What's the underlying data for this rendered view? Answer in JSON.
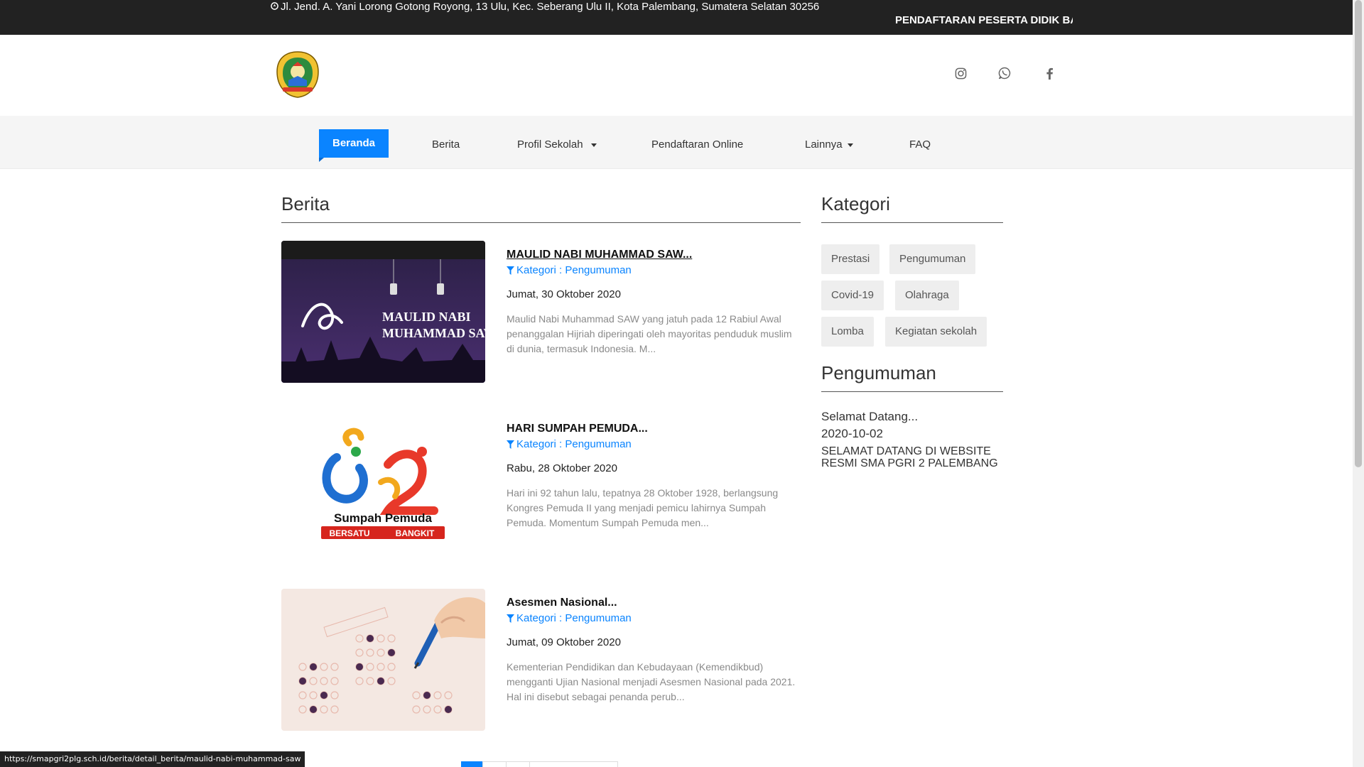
{
  "topbar": {
    "address": "Jl. Jend. A. Yani Lorong Gotong Royong, 13 Ulu, Kec. Seberang Ulu II, Kota Palembang, Sumatera Selatan 30256",
    "marquee": "PENDAFTARAN PESERTA DIDIK BA"
  },
  "header": {
    "social_icons": [
      "instagram-icon",
      "whatsapp-icon",
      "facebook-icon"
    ]
  },
  "nav": {
    "items": [
      {
        "label": "Beranda",
        "active": true
      },
      {
        "label": "Berita"
      },
      {
        "label": "Profil Sekolah",
        "dropdown": true
      },
      {
        "label": "Pendaftaran Online"
      },
      {
        "label": "Lainnya",
        "dropdown": true
      },
      {
        "label": "FAQ"
      }
    ]
  },
  "main": {
    "title": "Berita",
    "articles": [
      {
        "title": "MAULID NABI MUHAMMAD SAW...",
        "category": "Kategori : Pengumuman",
        "date": "Jumat, 30 Oktober 2020",
        "excerpt": "Maulid Nabi Muhammad SAW yang jatuh pada 12 Rabiul Awal penanggalan Hijriah diperingati oleh mayoritas penduduk muslim di dunia, termasuk Indonesia. M...",
        "image_text_1": "MAULID NABI",
        "image_text_2": "MUHAMMAD SAW"
      },
      {
        "title": "HARI SUMPAH PEMUDA...",
        "category": "Kategori : Pengumuman",
        "date": "Rabu, 28 Oktober 2020",
        "excerpt": "Hari ini 92 tahun lalu, tepatnya 28 Oktober 1928, berlangsung Kongres Pemuda II yang menjadi pemicu lahirnya Sumpah Pemuda. Momentum Sumpah Pemuda men...",
        "image_text_1": "Sumpah Pemuda",
        "image_text_2": "BERSATU",
        "image_text_3": "BANGKIT"
      },
      {
        "title": "Asesmen Nasional...",
        "category": "Kategori : Pengumuman",
        "date": "Jumat, 09 Oktober 2020",
        "excerpt": "Kementerian Pendidikan dan Kebudayaan (Kemendikbud) mengganti Ujian Nasional menjadi Asesmen Nasional pada 2021. Hal ini disebut sebagai penanda perub..."
      }
    ]
  },
  "sidebar": {
    "kategori_title": "Kategori",
    "tags": [
      "Prestasi",
      "Pengumuman",
      "Covid-19",
      "Olahraga",
      "Lomba",
      "Kegiatan sekolah"
    ],
    "pengumuman_title": "Pengumuman",
    "announcement": {
      "title": "Selamat Datang...",
      "date": "2020-10-02",
      "body": "SELAMAT DATANG DI WEBSITE RESMI SMA PGRI 2 PALEMBANG"
    }
  },
  "status_url": "https://smapgri2plg.sch.id/berita/detail_berita/maulid-nabi-muhammad-saw",
  "colors": {
    "accent": "#0a84ff",
    "topbar": "#222222",
    "nav_bg": "#f5f5f5"
  }
}
